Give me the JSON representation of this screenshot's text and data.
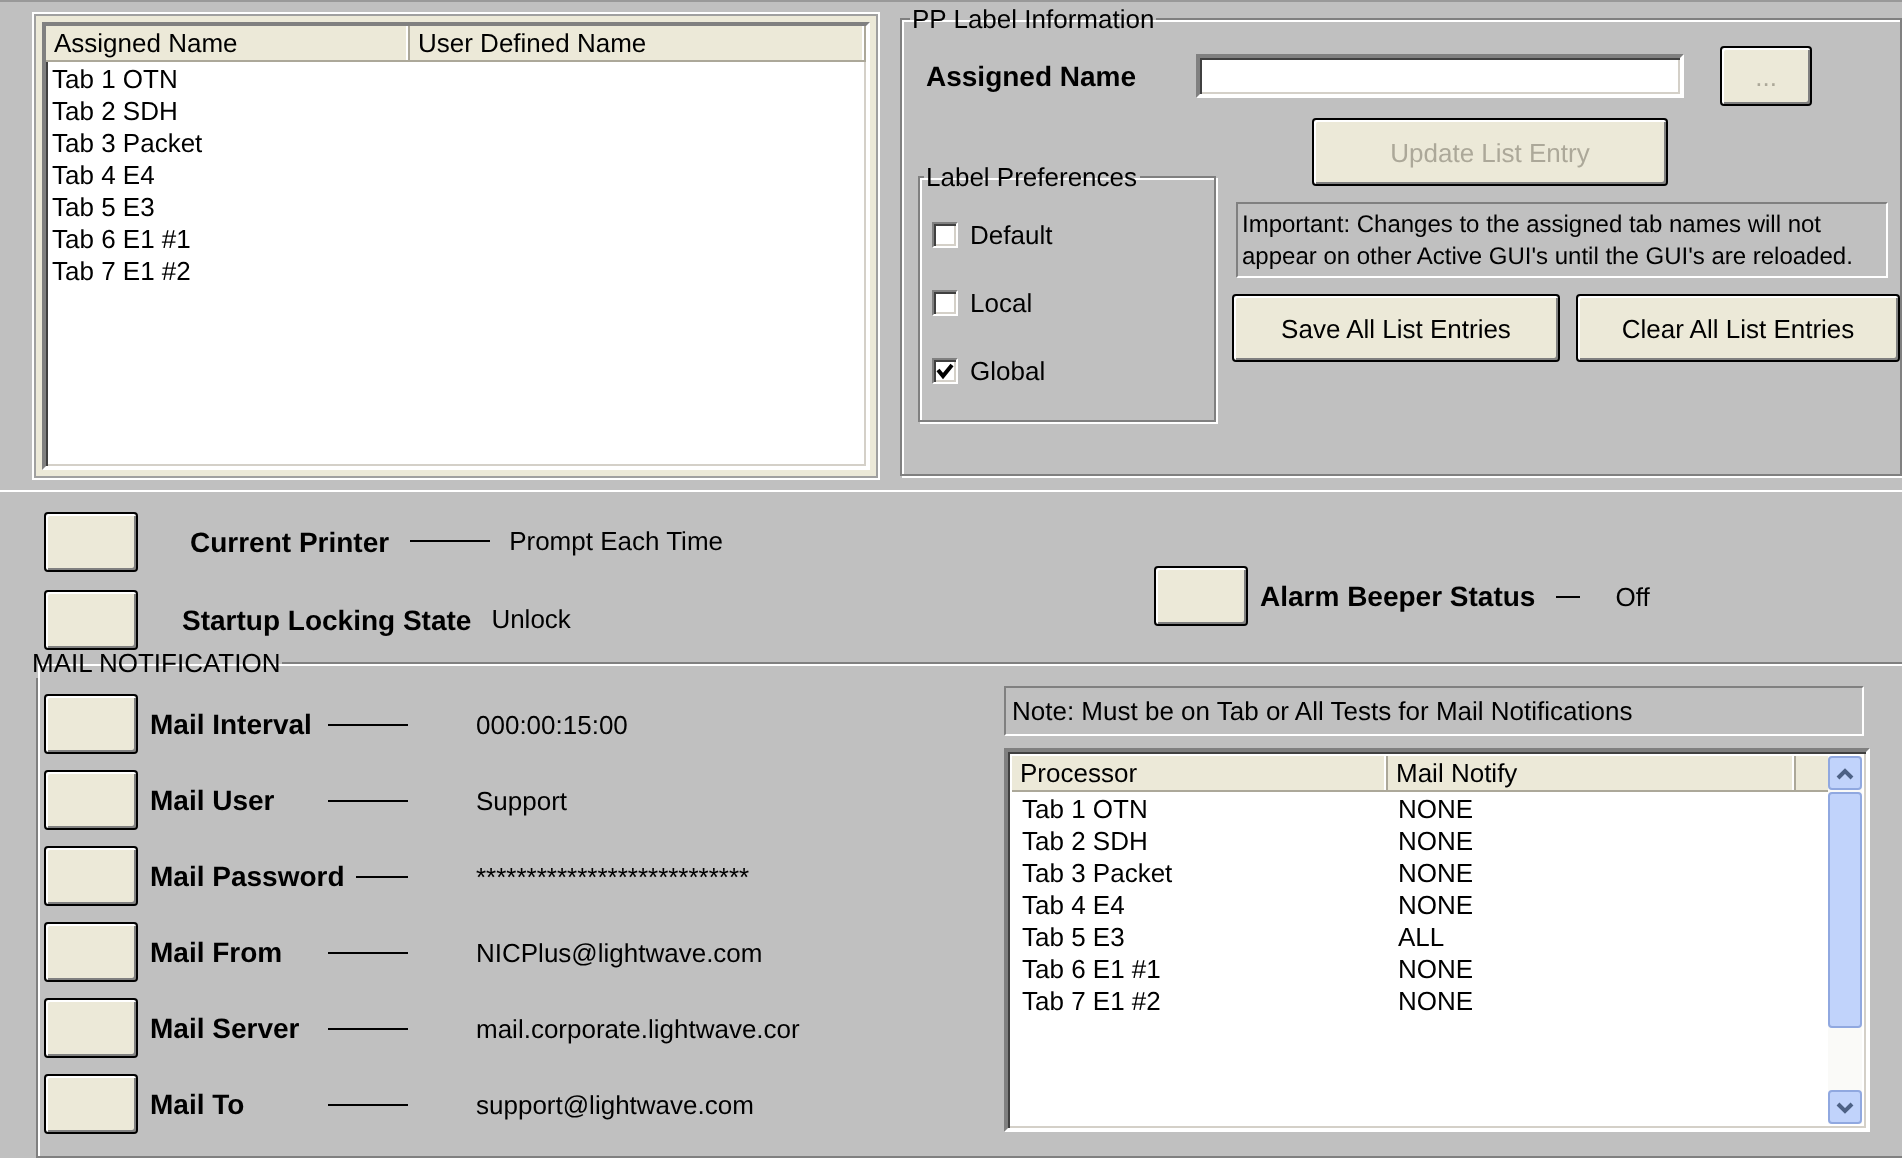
{
  "assigned_list": {
    "columns": [
      "Assigned Name",
      "User Defined Name"
    ],
    "rows": [
      {
        "assigned": "Tab 1 OTN"
      },
      {
        "assigned": "Tab 2 SDH"
      },
      {
        "assigned": "Tab 3 Packet"
      },
      {
        "assigned": "Tab 4 E4"
      },
      {
        "assigned": "Tab 5 E3"
      },
      {
        "assigned": "Tab 6 E1 #1"
      },
      {
        "assigned": "Tab 7 E1 #2"
      }
    ]
  },
  "pp_label": {
    "title": "PP Label Information",
    "assigned_name_label": "Assigned Name",
    "browse_button": {
      "label": "...",
      "disabled": true
    },
    "update_button": {
      "label": "Update List Entry",
      "disabled": true
    },
    "preferences": {
      "title": "Label Preferences",
      "options": [
        {
          "label": "Default",
          "checked": false
        },
        {
          "label": "Local",
          "checked": false
        },
        {
          "label": "Global",
          "checked": true
        }
      ]
    },
    "note": "Important: Changes to the assigned tab names will not appear on other Active GUI's until the GUI's are reloaded.",
    "save_button": "Save All List Entries",
    "clear_button": "Clear All List Entries"
  },
  "settings": [
    {
      "label": "Current Printer",
      "value": "Prompt Each Time",
      "leader": true
    },
    {
      "label": "Startup Locking State",
      "value": "Unlock",
      "leader": false
    }
  ],
  "alarm": {
    "label": "Alarm Beeper Status",
    "value": "Off"
  },
  "mail": {
    "title": "MAIL NOTIFICATION",
    "fields": [
      {
        "label": "Mail Interval",
        "value": "000:00:15:00"
      },
      {
        "label": "Mail User",
        "value": "Support"
      },
      {
        "label": "Mail Password",
        "value": "***************************"
      },
      {
        "label": "Mail From",
        "value": "NICPlus@lightwave.com"
      },
      {
        "label": "Mail Server",
        "value": "mail.corporate.lightwave.cor"
      },
      {
        "label": "Mail To",
        "value": "support@lightwave.com"
      }
    ],
    "note": "Note: Must be on Tab or All Tests for Mail Notifications",
    "table": {
      "columns": [
        "Processor",
        "Mail Notify"
      ],
      "rows": [
        {
          "processor": "Tab 1 OTN",
          "notify": "NONE"
        },
        {
          "processor": "Tab 2 SDH",
          "notify": "NONE"
        },
        {
          "processor": "Tab 3 Packet",
          "notify": "NONE"
        },
        {
          "processor": "Tab 4 E4",
          "notify": "NONE"
        },
        {
          "processor": "Tab 5 E3",
          "notify": "ALL"
        },
        {
          "processor": "Tab 6 E1 #1",
          "notify": "NONE"
        },
        {
          "processor": "Tab 7 E1 #2",
          "notify": "NONE"
        }
      ]
    }
  }
}
